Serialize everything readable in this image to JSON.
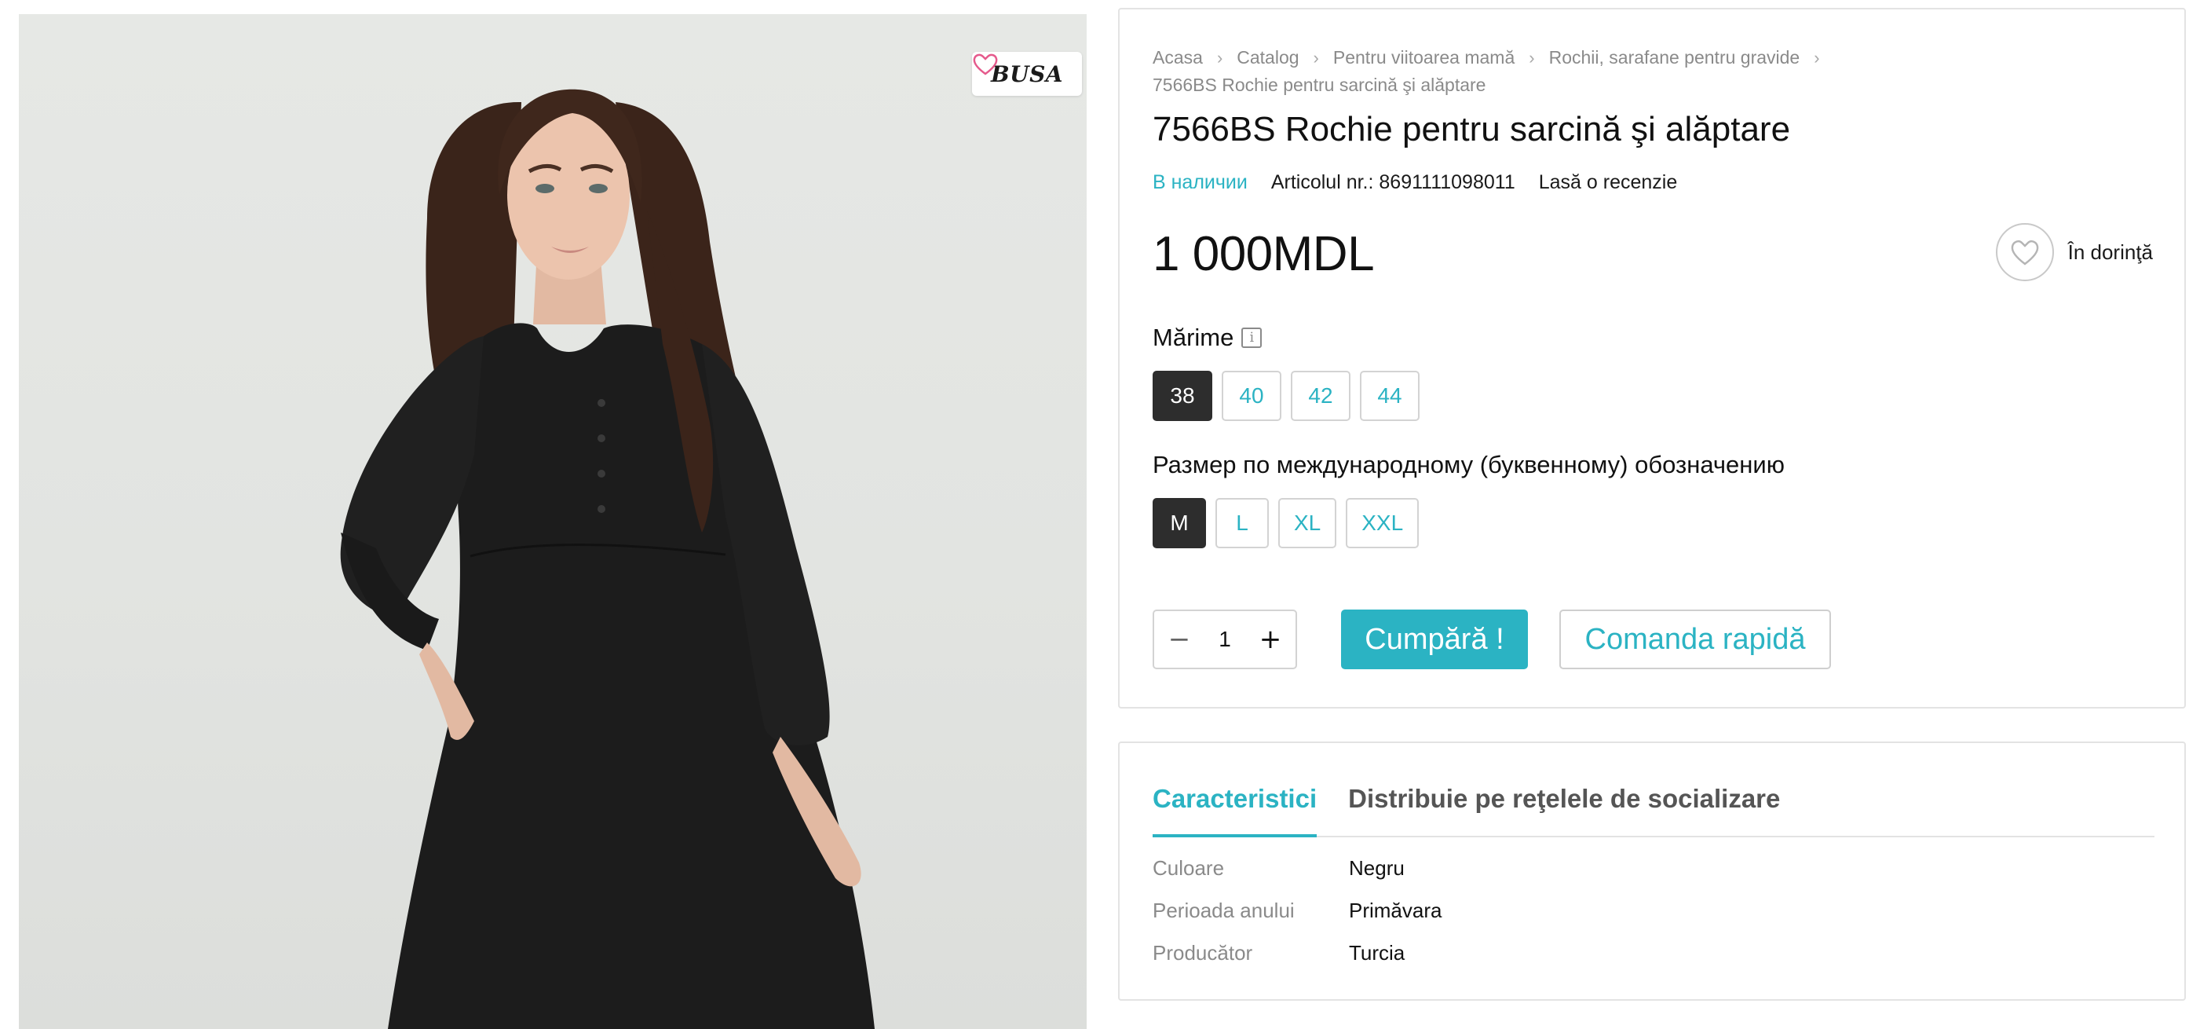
{
  "brand": {
    "logo_text": "BUSA"
  },
  "breadcrumb": {
    "items": [
      "Acasa",
      "Catalog",
      "Pentru viitoarea mamă",
      "Rochii, sarafane pentru gravide",
      "7566BS Rochie pentru sarcină şi alăptare"
    ],
    "separator": ">"
  },
  "product": {
    "title": "7566BS Rochie pentru sarcină şi alăptare",
    "stock_status": "В наличии",
    "article": "Articolul nr.: 8691111098011",
    "review_link": "Lasă o recenzie",
    "price": "1 000MDL"
  },
  "wishlist": {
    "label": "În dorinţă",
    "icon": "heart-icon"
  },
  "sizes": {
    "label": "Mărime",
    "info_icon": "i",
    "options": [
      "38",
      "40",
      "42",
      "44"
    ],
    "selected": "38"
  },
  "letter_sizes": {
    "label": "Размер по международному (буквенному) обозначению",
    "options": [
      "M",
      "L",
      "XL",
      "XXL"
    ],
    "selected": "M"
  },
  "quantity": {
    "value": "1",
    "minus": "−",
    "plus": "+"
  },
  "actions": {
    "buy": "Cumpără !",
    "quick_order": "Comanda rapidă"
  },
  "tabs": {
    "items": [
      "Caracteristici",
      "Distribuie pe reţelele de socializare"
    ],
    "active": "Caracteristici"
  },
  "specs": [
    {
      "key": "Culoare",
      "value": "Negru"
    },
    {
      "key": "Perioada anului",
      "value": "Primăvara"
    },
    {
      "key": "Producător",
      "value": "Turcia"
    }
  ],
  "colors": {
    "accent": "#2bb3c3",
    "selected_option": "#2d2d2d",
    "muted_text": "#8a8a8a",
    "border": "#e3e3e3"
  }
}
